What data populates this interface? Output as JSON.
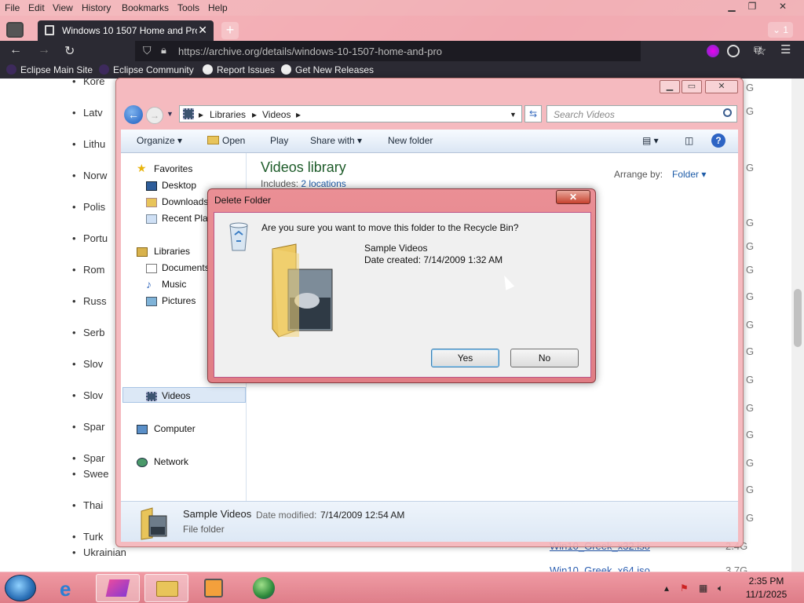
{
  "browser": {
    "menu": [
      "File",
      "Edit",
      "View",
      "History",
      "Bookmarks",
      "Tools",
      "Help"
    ],
    "tab_title": "Windows 10 1507 Home and Pro",
    "tab_count": "1",
    "url": "https://archive.org/details/windows-10-1507-home-and-pro",
    "bookmarks": [
      "Eclipse Main Site",
      "Eclipse Community",
      "Report Issues",
      "Get New Releases"
    ]
  },
  "webpage": {
    "languages": [
      "Kore",
      "Latv",
      "Lithu",
      "Norw",
      "Polis",
      "Portu",
      "Rom",
      "Russ",
      "Serb",
      "Slov",
      "Slov",
      "Spar",
      "Spar",
      "Swee",
      "Thai",
      "Turk",
      "Ukrainian"
    ],
    "sizes": [
      "G",
      "G",
      "G",
      "G",
      "G",
      "G",
      "G",
      "G",
      "G",
      "G",
      "G",
      "G",
      "G",
      "G",
      "G",
      "2.4G",
      "3.7G"
    ],
    "files": [
      "Win10_Greek_x32.iso",
      "Win10_Greek_x64.iso"
    ]
  },
  "explorer": {
    "breadcrumb": [
      "Libraries",
      "Videos"
    ],
    "search_placeholder": "Search Videos",
    "commands": [
      "Organize",
      "Open",
      "Play",
      "Share with",
      "New folder"
    ],
    "nav": {
      "favorites": "Favorites",
      "favorites_items": [
        "Desktop",
        "Downloads",
        "Recent Places"
      ],
      "libraries": "Libraries",
      "libraries_items": [
        "Documents",
        "Music",
        "Pictures",
        "Videos"
      ],
      "computer": "Computer",
      "network": "Network"
    },
    "library_title": "Videos library",
    "includes_label": "Includes:",
    "includes_value": "2 locations",
    "arrange_label": "Arrange by:",
    "arrange_value": "Folder",
    "details": {
      "name": "Sample Videos",
      "modified_label": "Date modified:",
      "modified_value": "7/14/2009 12:54 AM",
      "type": "File folder"
    }
  },
  "dialog": {
    "title": "Delete Folder",
    "question": "Are you sure you want to move this folder to the Recycle Bin?",
    "item_name": "Sample Videos",
    "item_date": "Date created: 7/14/2009 1:32 AM",
    "yes": "Yes",
    "no": "No"
  },
  "taskbar": {
    "time": "2:35 PM",
    "date": "11/1/2025"
  }
}
